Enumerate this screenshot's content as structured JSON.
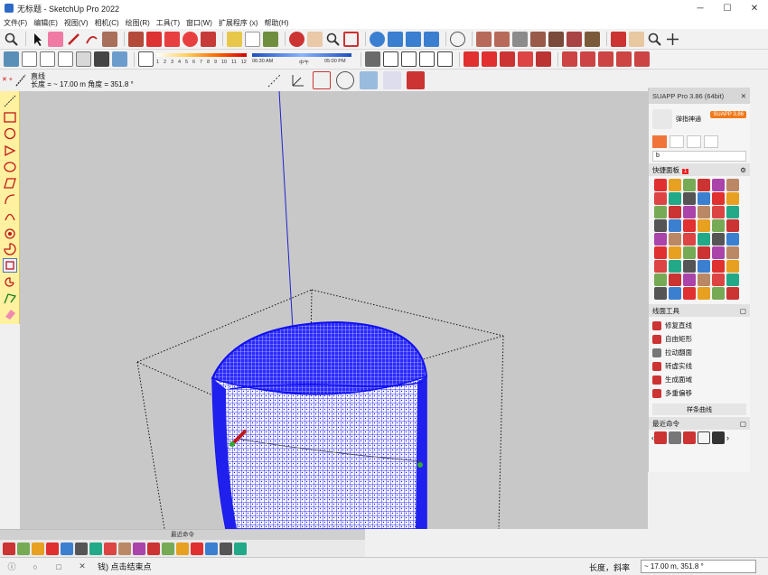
{
  "window": {
    "title": "无标题 - SketchUp Pro 2022",
    "minimize": "─",
    "maximize": "☐",
    "close": "✕"
  },
  "menu": [
    "文件(F)",
    "编辑(E)",
    "视图(V)",
    "相机(C)",
    "绘图(R)",
    "工具(T)",
    "窗口(W)",
    "扩展程序 (x)",
    "帮助(H)"
  ],
  "toolbar2": {
    "shadow_ramp_ticks": [
      "1",
      "2",
      "3",
      "4",
      "5",
      "6",
      "7",
      "8",
      "9",
      "10",
      "11",
      "12"
    ],
    "time_start": "06:30 AM",
    "time_mid": "中午",
    "time_end": "05:00 PM"
  },
  "measure": {
    "tool_name": "直线",
    "length_label": "长度 = ~ 17.00 m  角度 = 351.8 °",
    "arrows": "✕ +"
  },
  "panel": {
    "title": "SUAPP Pro 3.86 (64bit)",
    "close": "✕",
    "user_name": "弹指神通",
    "pro_badge": "SUAPP 3.86",
    "search_value": "b",
    "quick_panel_label": "快捷面板",
    "quick_panel_count": "1",
    "line_tools_label": "线面工具",
    "line_tools": [
      "修复直线",
      "自由矩形",
      "拉动翻面",
      "转虚实线",
      "生成面域",
      "多重偏移"
    ],
    "subtab_label": "样条曲线",
    "recent_label": "最近命令"
  },
  "bottom_recent": {
    "label": "最近命令"
  },
  "status": {
    "hint": "钱) 点击结束点",
    "field_label": "长度，斜率",
    "field_value": "~ 17.00 m, 351.8 °"
  },
  "colors": {
    "mesh_blue": "#1a1aff",
    "accent_orange": "#f0743a",
    "panel_badge": "#f07a1a",
    "left_toolbar": "#fff1a0"
  }
}
